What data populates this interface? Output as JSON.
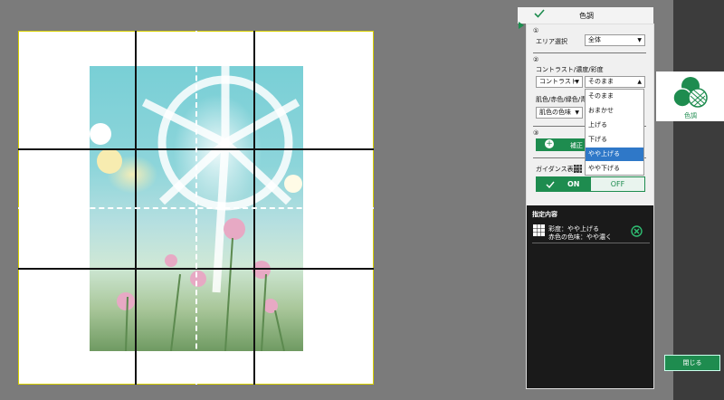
{
  "panel": {
    "title": "色調",
    "step1": "①",
    "area_label": "エリア選択",
    "area_value": "全体",
    "step2": "②",
    "contrast_label": "コントラスト/濃度/彩度",
    "contrast_select": "コントラスト",
    "level_select": "そのまま",
    "skin_label": "肌色/赤色/緑色/青",
    "skin_select": "肌色の色味",
    "step3": "③",
    "correct_button": "補正",
    "guidance_label": "ガイダンス表示",
    "toggle_on": "ON",
    "toggle_off": "OFF",
    "dropdown_options": [
      "そのまま",
      "おまかせ",
      "上げる",
      "下げる",
      "やや上げる",
      "やや下げる"
    ],
    "dropdown_selected_index": 4,
    "specified_title": "指定内容",
    "spec_line1": "彩度：やや上げる",
    "spec_line2": "赤色の色味：やや濃く"
  },
  "side_tab": {
    "label": "色調"
  },
  "close_button": "閉じる"
}
